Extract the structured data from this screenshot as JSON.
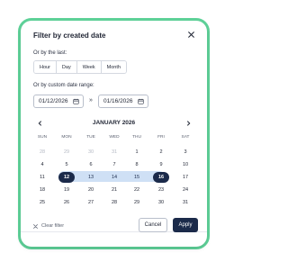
{
  "dialog": {
    "title": "Filter by created date",
    "accent_color": "#5fd39a",
    "primary_color": "#1b2a4a",
    "range_color": "#cfe0f5"
  },
  "last": {
    "label": "Or by the last:",
    "options": [
      "Hour",
      "Day",
      "Week",
      "Month"
    ]
  },
  "custom": {
    "label": "Or by custom date range:",
    "start": "01/12/2026",
    "end": "01/16/2026",
    "separator": "»"
  },
  "calendar": {
    "month_label": "JANUARY 2026",
    "weekdays": [
      "SUN",
      "MON",
      "TUE",
      "WED",
      "THU",
      "FRI",
      "SAT"
    ],
    "weeks": [
      [
        "28",
        "29",
        "30",
        "31",
        "1",
        "2",
        "3"
      ],
      [
        "4",
        "5",
        "6",
        "7",
        "8",
        "9",
        "10"
      ],
      [
        "11",
        "12",
        "13",
        "14",
        "15",
        "16",
        "17"
      ],
      [
        "18",
        "19",
        "20",
        "21",
        "22",
        "23",
        "24"
      ],
      [
        "25",
        "26",
        "27",
        "28",
        "29",
        "30",
        "31"
      ]
    ],
    "outside_month": [
      [
        0,
        0
      ],
      [
        0,
        1
      ],
      [
        0,
        2
      ],
      [
        0,
        3
      ]
    ],
    "range_start": "12",
    "range_end": "16",
    "in_range": [
      "13",
      "14",
      "15"
    ]
  },
  "footer": {
    "clear_label": "Clear filter",
    "cancel_label": "Cancel",
    "apply_label": "Apply"
  },
  "icons": [
    "close-icon",
    "calendar-icon",
    "chevron-left-icon",
    "chevron-right-icon",
    "clear-icon"
  ]
}
